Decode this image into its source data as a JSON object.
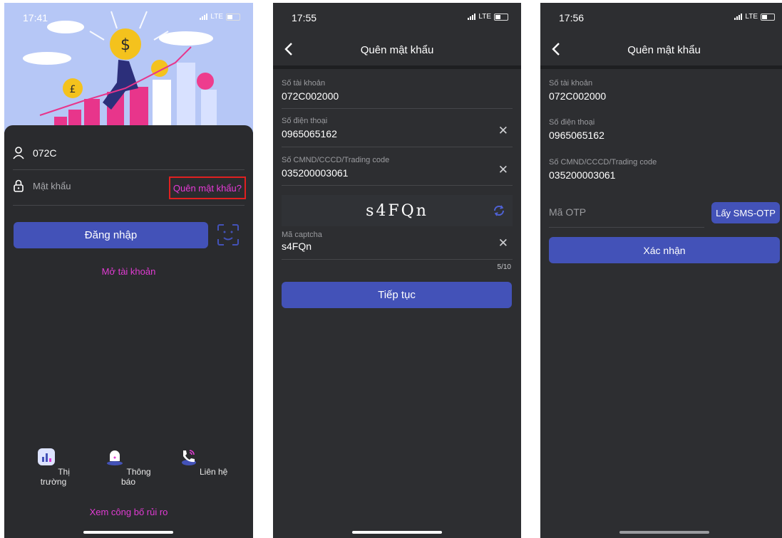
{
  "login": {
    "time": "17:41",
    "network": "LTE",
    "account": "072C",
    "password_placeholder": "Mật khẩu",
    "forgot_password": "Quên mật khẩu?",
    "login_button": "Đăng nhập",
    "open_account": "Mở tài khoản",
    "tabs": [
      {
        "label": "Thị trường",
        "icon": "market-icon"
      },
      {
        "label": "Thông báo",
        "icon": "notification-bell-icon"
      },
      {
        "label": "Liên hệ",
        "icon": "contact-phone-icon"
      }
    ],
    "risk_disclosure": "Xem công bố rủi ro"
  },
  "forgot_step1": {
    "time": "17:55",
    "network": "LTE",
    "title": "Quên mật khẩu",
    "account_label": "Số tài khoản",
    "account_value": "072C002000",
    "phone_label": "Số điện thoại",
    "phone_value": "0965065162",
    "id_label": "Số CMND/CCCD/Trading code",
    "id_value": "035200003061",
    "captcha_image_text": "s4FQn",
    "captcha_label": "Mã captcha",
    "captcha_value": "s4FQn",
    "captcha_counter": "5/10",
    "continue_button": "Tiếp tục"
  },
  "forgot_step2": {
    "time": "17:56",
    "network": "LTE",
    "title": "Quên mật khẩu",
    "account_label": "Số tài khoản",
    "account_value": "072C002000",
    "phone_label": "Số điện thoại",
    "phone_value": "0965065162",
    "id_label": "Số CMND/CCCD/Trading code",
    "id_value": "035200003061",
    "otp_placeholder": "Mã OTP",
    "get_otp_button": "Lấy SMS-OTP",
    "confirm_button": "Xác nhận"
  },
  "colors": {
    "accent": "#4352b8",
    "pink": "#e13bd3",
    "background": "#2d2e31",
    "highlight_box": "#e02020"
  }
}
